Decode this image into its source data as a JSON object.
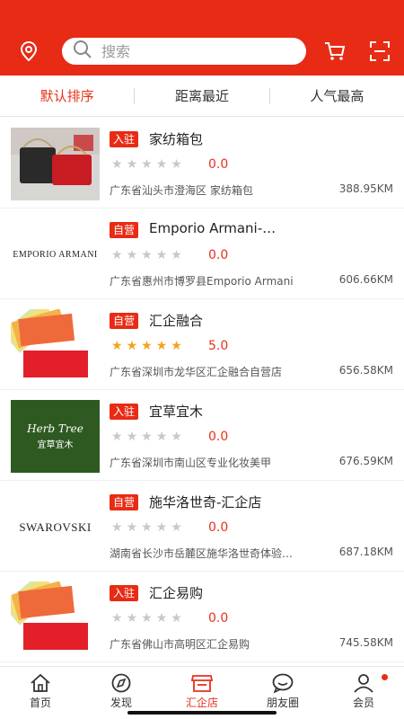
{
  "header": {
    "search_placeholder": "搜索",
    "icons": [
      "location-icon",
      "search-icon",
      "cart-icon",
      "scan-icon"
    ]
  },
  "tabs": [
    {
      "label": "默认排序",
      "active": true
    },
    {
      "label": "距离最近",
      "active": false
    },
    {
      "label": "人气最高",
      "active": false
    }
  ],
  "stores": [
    {
      "badge": "入驻",
      "name": "家纺箱包",
      "stars": 0,
      "rating": "0.0",
      "address": "广东省汕头市澄海区 家纺箱包",
      "distance": "388.95KM",
      "thumb": "bags-photo"
    },
    {
      "badge": "自营",
      "name": "Emporio Armani-…",
      "stars": 0,
      "rating": "0.0",
      "address": "广东省惠州市博罗县Emporio Armani",
      "distance": "606.66KM",
      "thumb_text": "EMPORIO ARMANI"
    },
    {
      "badge": "自营",
      "name": "汇企融合",
      "stars": 5,
      "rating": "5.0",
      "address": "广东省深圳市龙华区汇企融合自营店",
      "distance": "656.58KM",
      "thumb": "cards-logo"
    },
    {
      "badge": "入驻",
      "name": "宜草宜木",
      "stars": 0,
      "rating": "0.0",
      "address": "广东省深圳市南山区专业化妆美甲",
      "distance": "676.59KM",
      "thumb_text": "Herb Tree",
      "thumb_text2": "宜草宜木"
    },
    {
      "badge": "自营",
      "name": "施华洛世奇-汇企店",
      "stars": 0,
      "rating": "0.0",
      "address": "湖南省长沙市岳麓区施华洛世奇体验…",
      "distance": "687.18KM",
      "thumb_text": "SWAROVSKI"
    },
    {
      "badge": "入驻",
      "name": "汇企易购",
      "stars": 0,
      "rating": "0.0",
      "address": "广东省佛山市高明区汇企易购",
      "distance": "745.58KM",
      "thumb": "cards-logo"
    }
  ],
  "bottom_nav": [
    {
      "label": "首页",
      "icon": "home-icon",
      "active": false
    },
    {
      "label": "发现",
      "icon": "compass-icon",
      "active": false
    },
    {
      "label": "汇企店",
      "icon": "store-icon",
      "active": true
    },
    {
      "label": "朋友圈",
      "icon": "chat-icon",
      "active": false
    },
    {
      "label": "会员",
      "icon": "user-icon",
      "active": false,
      "dot": true
    }
  ],
  "colors": {
    "brand": "#e82b14",
    "star_on": "#f5a21a",
    "star_off": "#c8c8c8"
  }
}
